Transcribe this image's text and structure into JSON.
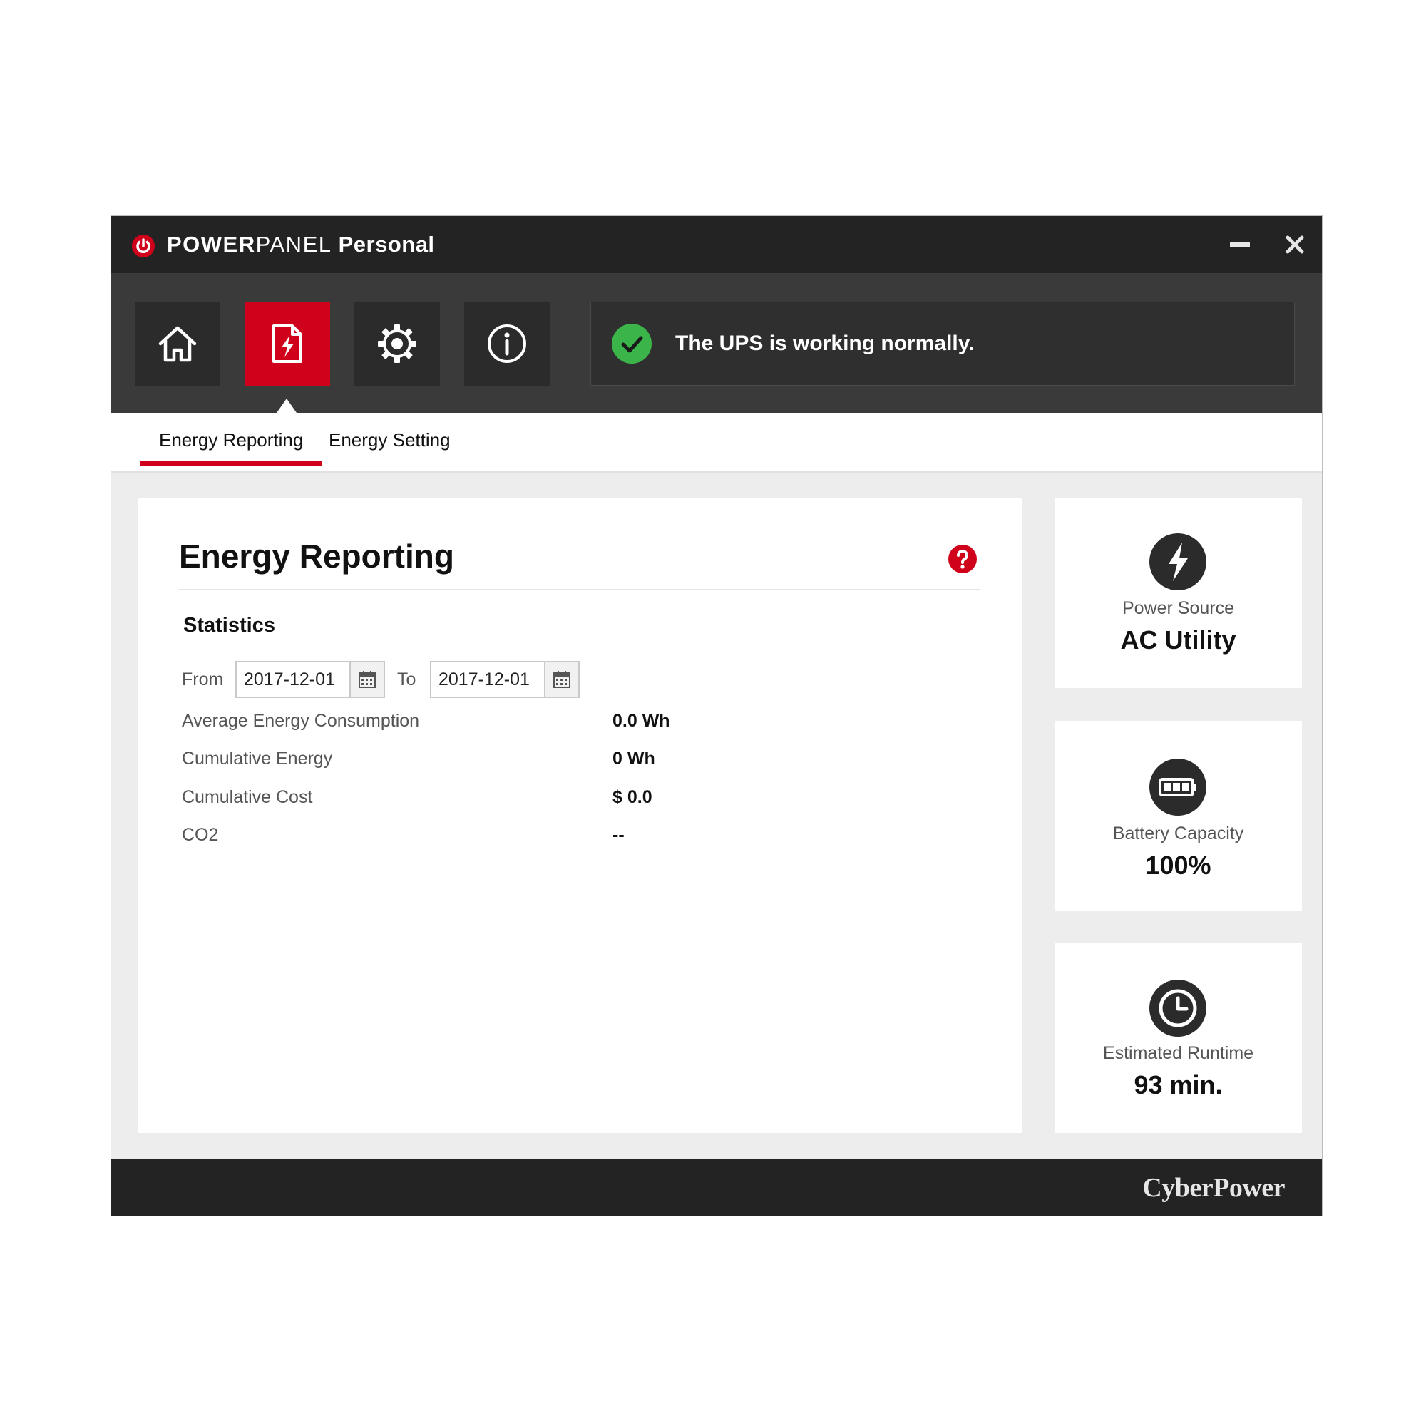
{
  "app": {
    "title_part1": "POWER",
    "title_part2": "PANEL",
    "title_part3": " Personal",
    "icons": {
      "logo": "power-logo-icon",
      "minimize": "minimize-icon",
      "close": "close-icon"
    }
  },
  "nav": {
    "items": [
      {
        "id": "home",
        "icon": "home-icon",
        "active": false
      },
      {
        "id": "energy",
        "icon": "energy-report-icon",
        "active": true
      },
      {
        "id": "settings",
        "icon": "gear-icon",
        "active": false
      },
      {
        "id": "info",
        "icon": "info-icon",
        "active": false
      }
    ]
  },
  "status": {
    "text": "The UPS is working normally.",
    "icon": "check-circle-icon",
    "color": "#3bb54a"
  },
  "subtabs": [
    {
      "label": "Energy Reporting",
      "active": true
    },
    {
      "label": "Energy Setting",
      "active": false
    }
  ],
  "main": {
    "title": "Energy Reporting",
    "help_icon": "help-icon",
    "section_title": "Statistics",
    "from_label": "From",
    "to_label": "To",
    "from_value": "2017-12-01",
    "to_value": "2017-12-01",
    "calendar_icon": "calendar-icon",
    "stats": [
      {
        "label": "Average Energy Consumption",
        "value": "0.0 Wh"
      },
      {
        "label": "Cumulative Energy",
        "value": "0 Wh"
      },
      {
        "label": "Cumulative Cost",
        "value": "$ 0.0"
      },
      {
        "label": "CO2",
        "value": "--"
      }
    ]
  },
  "cards": [
    {
      "label": "Power Source",
      "value": "AC Utility",
      "icon": "lightning-icon"
    },
    {
      "label": "Battery Capacity",
      "value": "100%",
      "icon": "battery-icon"
    },
    {
      "label": "Estimated Runtime",
      "value": "93 min.",
      "icon": "clock-icon"
    }
  ],
  "footer": {
    "brand": "CyberPower"
  },
  "colors": {
    "accent": "#d0021b",
    "titlebar": "#232323",
    "navband": "#3a3a3a",
    "ok": "#3bb54a"
  }
}
